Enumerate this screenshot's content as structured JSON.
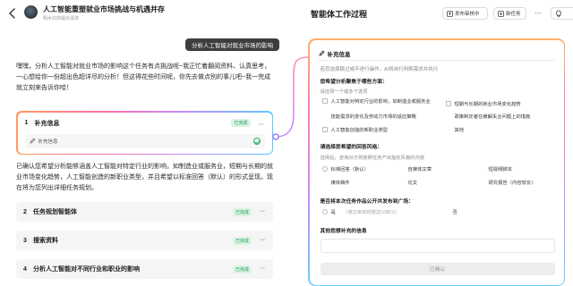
{
  "header": {
    "task_title": "人工智能重塑就业市场挑战与机遇并存",
    "task_subtitle": "明水向你提出请求",
    "right_title": "智能体工作过程",
    "publish_label": "发布审核中",
    "new_task_label": "新任务",
    "more_label": "···"
  },
  "chat": {
    "user_message": "分析人工智能对就业市场的影响",
    "intro_text": "嘿嘿，分析人工智能对就业市场的影响这个任务有点挑战呢~我正忙着翻阅资料、认真思考，一心想给你一份超出色超详尽的分析！但这得花些时间呢，你先去做点别的事儿吧~我一完成就立刻来告诉你哈！",
    "middle_text": "已确认您希望分析能够涵盖人工智能对特定行业的影响，如制造业或服务业，短期与长期的就业市场变化趋势，人工智能创造的新职业类型，并且希望以标准回答（默认）的形式呈现。现在将为您列出详细任务规划。",
    "steps": [
      {
        "num": "1",
        "label": "补充信息",
        "status": "已完成",
        "sub_label": "补充信息"
      },
      {
        "num": "2",
        "label": "任务规划智能体",
        "status": "已完成"
      },
      {
        "num": "3",
        "label": "搜索资料",
        "status": "已完成"
      },
      {
        "num": "4",
        "label": "分析人工智能对不同行业和职业的影响",
        "status": "已完成"
      }
    ]
  },
  "panel": {
    "title": "补充信息",
    "note": "若您选择跳过或不进行操作，AI将自行判断需求并执行",
    "q1": {
      "question": "您希望分析聚焦于哪些方面：",
      "hint": "请选择一个或多个选项",
      "options": [
        "人工智能对特定行业的影响，如制造业或服务业",
        "短期与长期的就业市场变化趋势",
        "技能需求的变化及劳动力市场的适应策略",
        "政策制定者在缓解失业问题上的措施",
        "人工智能创造的新职业类型",
        "其他"
      ]
    },
    "q2": {
      "question": "请选择您希望的回答风格：",
      "hint": "选择后，咨询对方将按照任务产出指定风格的内容",
      "options": [
        "标准回答（默认）",
        "自媒体文章",
        "短视频脚本",
        "媒体稿件",
        "论文",
        "研究报告（内容较长）"
      ]
    },
    "q3": {
      "question": "是否将本次任务作品公开并发布到广场：",
      "options": [
        "是",
        "（通过审核将赠送10积分）",
        "否"
      ]
    },
    "q4": {
      "question": "其他您想补充的信息"
    },
    "confirm_label": "已确认"
  }
}
